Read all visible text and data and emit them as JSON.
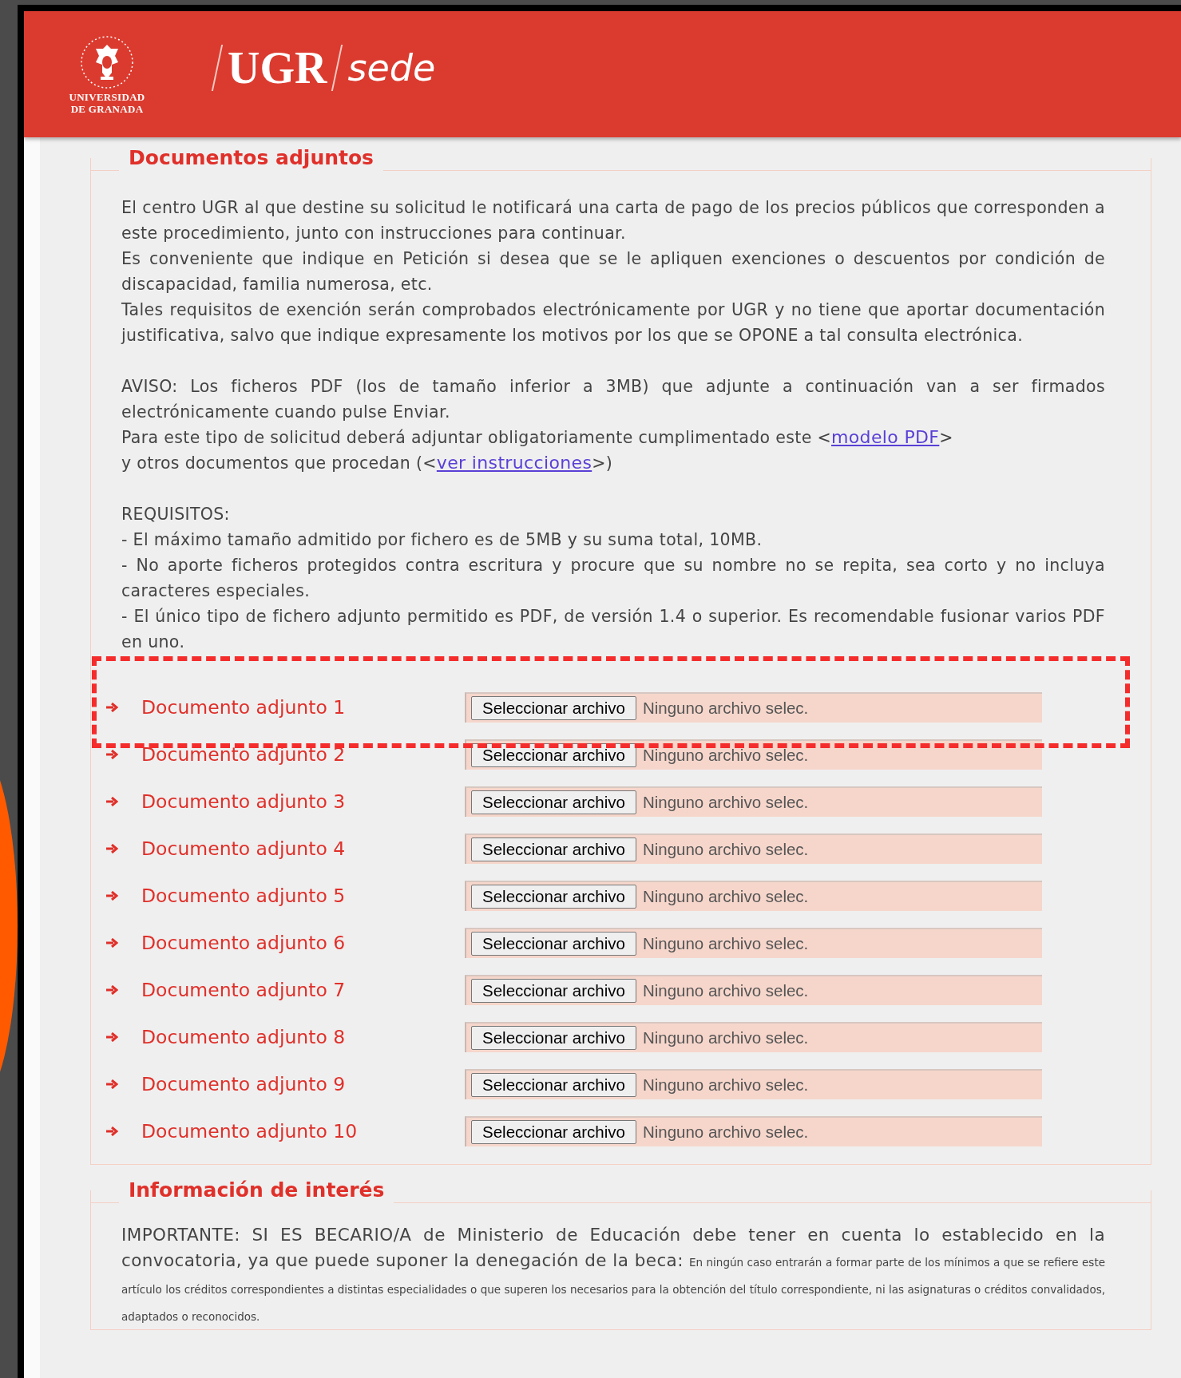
{
  "header": {
    "university_line1": "UNIVERSIDAD",
    "university_line2": "DE GRANADA",
    "brand": "UGR",
    "subbrand": "sede"
  },
  "documents": {
    "title": "Documentos adjuntos",
    "intro": [
      "El centro UGR al que destine su solicitud le notificará una carta de pago de los precios públicos que corresponden a este procedimiento, junto con instrucciones para continuar.",
      "Es conveniente que indique en Petición si desea que se le apliquen exenciones o descuentos por condición de discapacidad, familia numerosa, etc.",
      "Tales requisitos de exención serán comprobados electrónicamente por UGR y no tiene que aportar documentación justificativa, salvo que indique expresamente los motivos por los que se OPONE a tal consulta electrónica."
    ],
    "notice": "AVISO: Los ficheros PDF (los de tamaño inferior a 3MB) que adjunte a continuación van a ser firmados electrónicamente cuando pulse Enviar.",
    "link_lines": [
      {
        "before": "Para este tipo de solicitud deberá adjuntar obligatoriamente cumplimentado este <",
        "link": "modelo PDF",
        "after": ">"
      },
      {
        "before": "y otros documentos que procedan (<",
        "link": "ver instrucciones",
        "after": ">)"
      }
    ],
    "requirements_title": "REQUISITOS:",
    "requirements": [
      "- El máximo tamaño admitido por fichero es de 5MB y su suma total, 10MB.",
      "- No aporte ficheros protegidos contra escritura y procure que su nombre no se repita, sea corto y no incluya caracteres especiales.",
      "- El único tipo de fichero adjunto permitido es PDF, de versión 1.4 o superior. Es recomendable fusionar varios PDF en uno."
    ],
    "attachments": [
      {
        "label": "Documento adjunto 1",
        "button": "Seleccionar archivo",
        "status": "Ninguno archivo selec.",
        "highlighted": true
      },
      {
        "label": "Documento adjunto 2",
        "button": "Seleccionar archivo",
        "status": "Ninguno archivo selec.",
        "highlighted": false
      },
      {
        "label": "Documento adjunto 3",
        "button": "Seleccionar archivo",
        "status": "Ninguno archivo selec.",
        "highlighted": false
      },
      {
        "label": "Documento adjunto 4",
        "button": "Seleccionar archivo",
        "status": "Ninguno archivo selec.",
        "highlighted": false
      },
      {
        "label": "Documento adjunto 5",
        "button": "Seleccionar archivo",
        "status": "Ninguno archivo selec.",
        "highlighted": false
      },
      {
        "label": "Documento adjunto 6",
        "button": "Seleccionar archivo",
        "status": "Ninguno archivo selec.",
        "highlighted": false
      },
      {
        "label": "Documento adjunto 7",
        "button": "Seleccionar archivo",
        "status": "Ninguno archivo selec.",
        "highlighted": false
      },
      {
        "label": "Documento adjunto 8",
        "button": "Seleccionar archivo",
        "status": "Ninguno archivo selec.",
        "highlighted": false
      },
      {
        "label": "Documento adjunto 9",
        "button": "Seleccionar archivo",
        "status": "Ninguno archivo selec.",
        "highlighted": false
      },
      {
        "label": "Documento adjunto 10",
        "button": "Seleccionar archivo",
        "status": "Ninguno archivo selec.",
        "highlighted": false
      }
    ]
  },
  "information": {
    "title": "Información de interés",
    "lead": "IMPORTANTE: SI ES BECARIO/A de Ministerio de Educación debe tener en cuenta lo establecido en la convocatoria, ya que puede suponer la denegación de la beca:",
    "note": "En ningún caso entrarán a formar parte de los mínimos a que se refiere este artículo los créditos correspondientes a distintas especialidades o que superen los necesarios para la obtención del título correspondiente, ni las asignaturas o créditos convalidados, adaptados o reconocidos."
  }
}
